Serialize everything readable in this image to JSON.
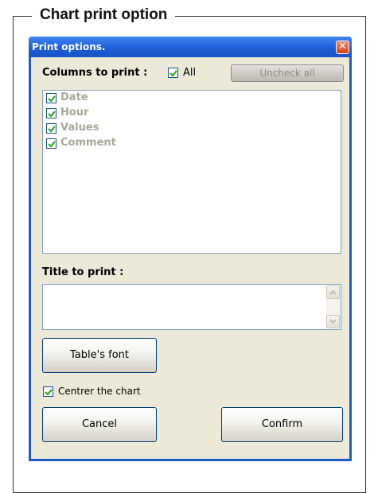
{
  "page": {
    "section_title": "Chart print option"
  },
  "dialog": {
    "title": "Print options.",
    "close_glyph": "✕",
    "columns_label": "Columns to print :",
    "all_label": "All",
    "all_checked": true,
    "uncheck_all_label": "Uncheck all",
    "columns": [
      {
        "label": "Date",
        "checked": true
      },
      {
        "label": "Hour",
        "checked": true
      },
      {
        "label": "Values",
        "checked": true
      },
      {
        "label": "Comment",
        "checked": true
      }
    ],
    "title_label": "Title to print :",
    "title_value": "",
    "font_button_label": "Table's font",
    "centre_label": "Centrer the chart",
    "centre_checked": true,
    "cancel_label": "Cancel",
    "confirm_label": "Confirm"
  },
  "icons": {
    "checkmark": "check-icon",
    "scroll_up": "scroll-up-arrow-icon",
    "scroll_down": "scroll-down-arrow-icon",
    "close": "close-icon"
  },
  "colors": {
    "titlebar": "#1d5ed8",
    "dialog_face": "#ece9d8",
    "check_green": "#21a121",
    "disabled_text": "#a7a69a"
  }
}
